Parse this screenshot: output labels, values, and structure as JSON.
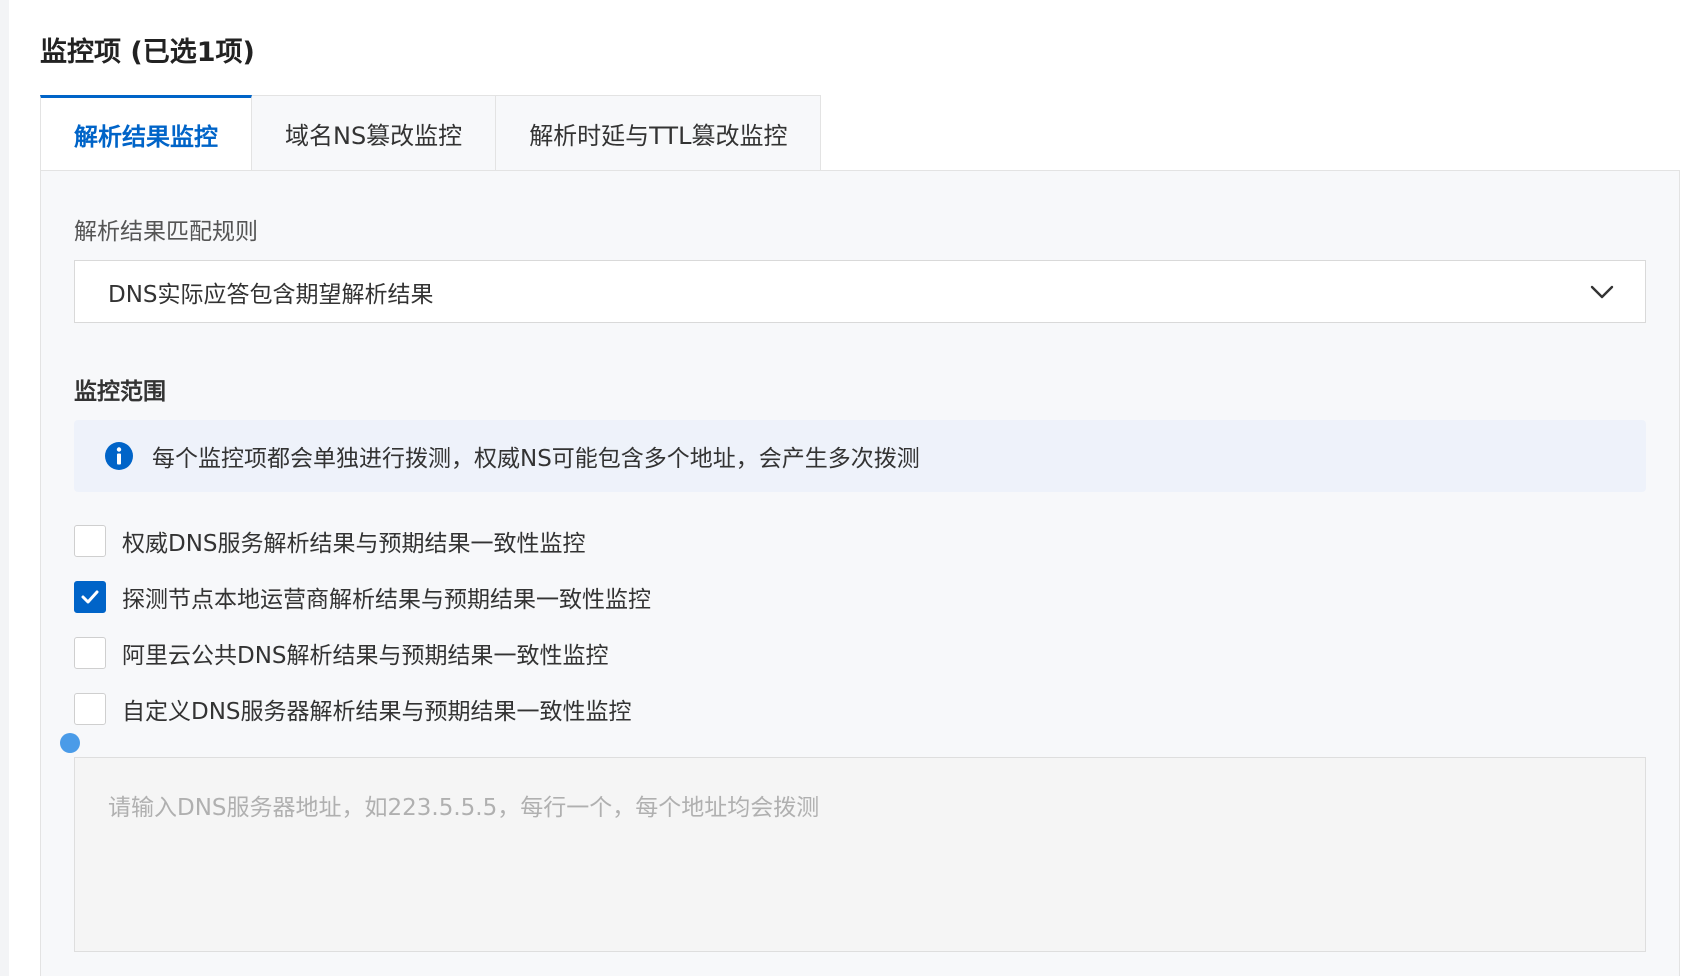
{
  "section": {
    "title": "监控项 (已选1项)"
  },
  "tabs": [
    {
      "label": "解析结果监控",
      "active": true
    },
    {
      "label": "域名NS篡改监控",
      "active": false
    },
    {
      "label": "解析时延与TTL篡改监控",
      "active": false
    }
  ],
  "match_rule": {
    "label": "解析结果匹配规则",
    "value": "DNS实际应答包含期望解析结果",
    "icon": "chevron-down-icon"
  },
  "scope": {
    "title": "监控范围",
    "notice": {
      "icon": "info-icon",
      "text": "每个监控项都会单独进行拨测，权威NS可能包含多个地址，会产生多次拨测"
    },
    "options": [
      {
        "label": "权威DNS服务解析结果与预期结果一致性监控",
        "checked": false
      },
      {
        "label": "探测节点本地运营商解析结果与预期结果一致性监控",
        "checked": true
      },
      {
        "label": "阿里云公共DNS解析结果与预期结果一致性监控",
        "checked": false
      },
      {
        "label": "自定义DNS服务器解析结果与预期结果一致性监控",
        "checked": false
      }
    ],
    "custom_dns": {
      "placeholder": "请输入DNS服务器地址，如223.5.5.5，每行一个，每个地址均会拨测",
      "value": ""
    }
  },
  "colors": {
    "accent": "#0064c8",
    "notice_bg": "#eef2fa",
    "panel_bg": "#f7f8fa"
  }
}
